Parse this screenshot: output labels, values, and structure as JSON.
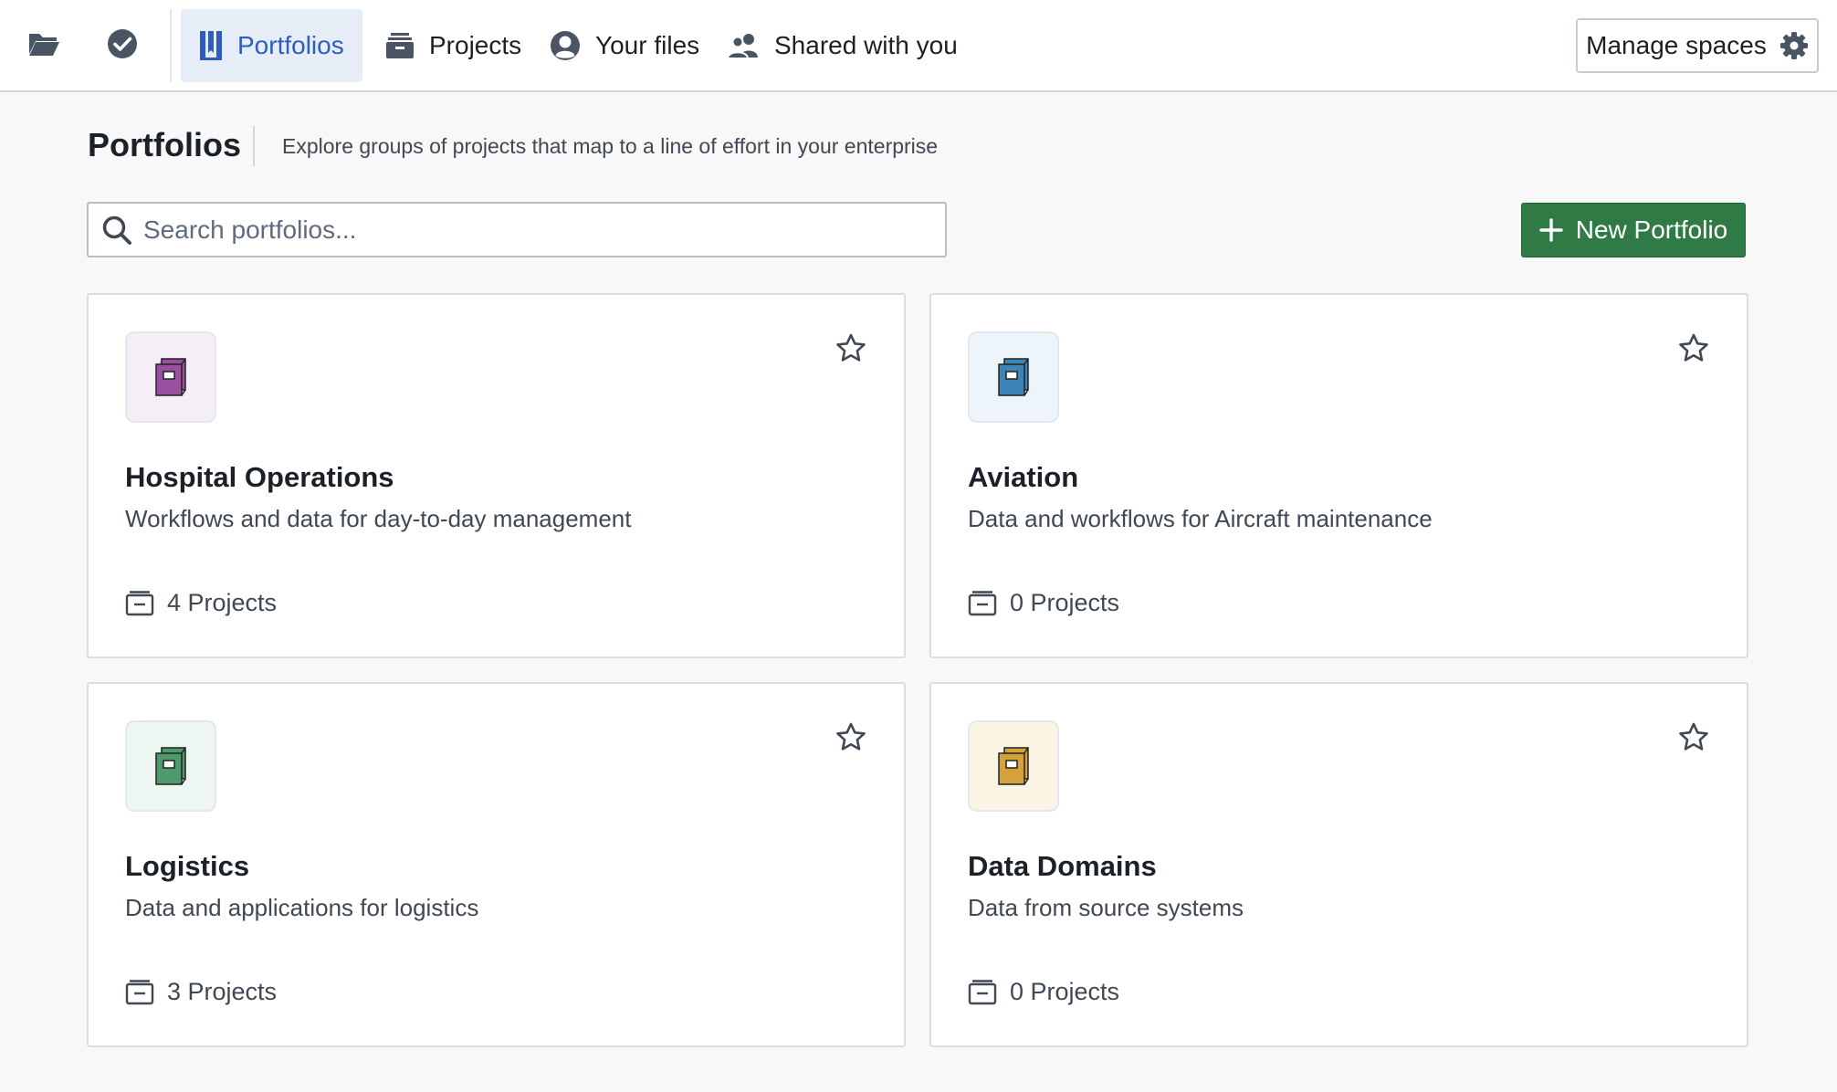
{
  "nav": {
    "tabs": [
      {
        "label": "Portfolios",
        "icon": "portfolio-icon",
        "active": true
      },
      {
        "label": "Projects",
        "icon": "projects-icon",
        "active": false
      },
      {
        "label": "Your files",
        "icon": "user-icon",
        "active": false
      },
      {
        "label": "Shared with you",
        "icon": "people-icon",
        "active": false
      }
    ],
    "manage_label": "Manage spaces"
  },
  "header": {
    "title": "Portfolios",
    "subtitle": "Explore groups of projects that map to a line of effort in your enterprise"
  },
  "search": {
    "placeholder": "Search portfolios..."
  },
  "new_button": {
    "label": "New Portfolio"
  },
  "colors": {
    "accent": "#2d5dbf",
    "primary_button": "#2f7a45"
  },
  "portfolios": [
    {
      "name": "Hospital Operations",
      "description": "Workflows and data for day-to-day management",
      "count": "4 Projects",
      "color": "#9b4f9f",
      "tint": "#f6eef6"
    },
    {
      "name": "Aviation",
      "description": "Data and workflows for Aircraft maintenance",
      "count": "0 Projects",
      "color": "#3f84b6",
      "tint": "#edf4fa"
    },
    {
      "name": "Logistics",
      "description": "Data and applications for logistics",
      "count": "3 Projects",
      "color": "#4f9a6d",
      "tint": "#eef6f1"
    },
    {
      "name": "Data Domains",
      "description": "Data from source systems",
      "count": "0 Projects",
      "color": "#d4a23a",
      "tint": "#fbf5e6"
    }
  ]
}
